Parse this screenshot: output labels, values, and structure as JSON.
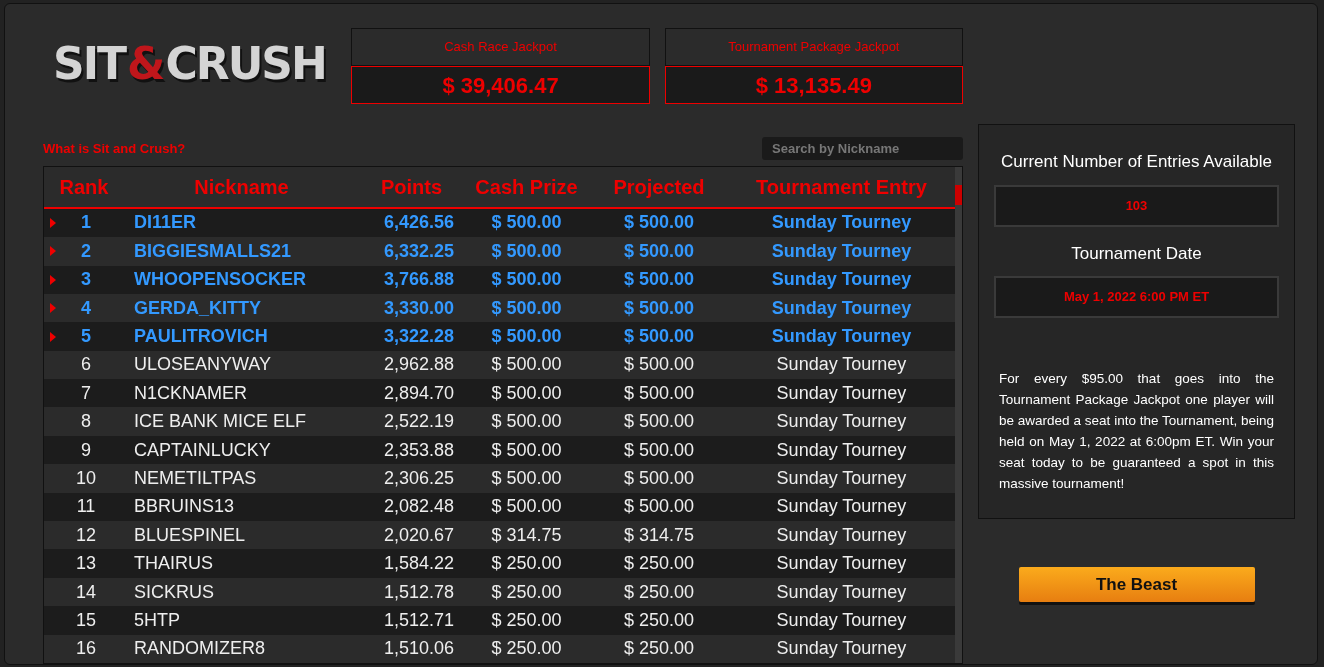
{
  "logo": {
    "word_1": "SIT",
    "ampersand": "&",
    "word_2": "CRUSH"
  },
  "jackpots": [
    {
      "label": "Cash Race Jackpot",
      "value": "$ 39,406.47"
    },
    {
      "label": "Tournament Package Jackpot",
      "value": "$ 13,135.49"
    }
  ],
  "info_link": "What is Sit and Crush?",
  "search": {
    "placeholder": "Search by Nickname"
  },
  "table": {
    "columns": [
      "Rank",
      "Nickname",
      "Points",
      "Cash Prize",
      "Projected",
      "Tournament Entry"
    ],
    "rows": [
      {
        "highlighted": true,
        "cells": [
          "1",
          "DI11ER",
          "6,426.56",
          "$ 500.00",
          "$ 500.00",
          "Sunday Tourney"
        ]
      },
      {
        "highlighted": true,
        "cells": [
          "2",
          "BIGGIESMALLS21",
          "6,332.25",
          "$ 500.00",
          "$ 500.00",
          "Sunday Tourney"
        ]
      },
      {
        "highlighted": true,
        "cells": [
          "3",
          "WHOOPENSOCKER",
          "3,766.88",
          "$ 500.00",
          "$ 500.00",
          "Sunday Tourney"
        ]
      },
      {
        "highlighted": true,
        "cells": [
          "4",
          "GERDA_KITTY",
          "3,330.00",
          "$ 500.00",
          "$ 500.00",
          "Sunday Tourney"
        ]
      },
      {
        "highlighted": true,
        "cells": [
          "5",
          "PAULITROVICH",
          "3,322.28",
          "$ 500.00",
          "$ 500.00",
          "Sunday Tourney"
        ]
      },
      {
        "highlighted": false,
        "cells": [
          "6",
          "ULOSEANYWAY",
          "2,962.88",
          "$ 500.00",
          "$ 500.00",
          "Sunday Tourney"
        ]
      },
      {
        "highlighted": false,
        "cells": [
          "7",
          "N1CKNAMER",
          "2,894.70",
          "$ 500.00",
          "$ 500.00",
          "Sunday Tourney"
        ]
      },
      {
        "highlighted": false,
        "cells": [
          "8",
          "ICE BANK MICE ELF",
          "2,522.19",
          "$ 500.00",
          "$ 500.00",
          "Sunday Tourney"
        ]
      },
      {
        "highlighted": false,
        "cells": [
          "9",
          "CAPTAINLUCKY",
          "2,353.88",
          "$ 500.00",
          "$ 500.00",
          "Sunday Tourney"
        ]
      },
      {
        "highlighted": false,
        "cells": [
          "10",
          "NEMETILTPAS",
          "2,306.25",
          "$ 500.00",
          "$ 500.00",
          "Sunday Tourney"
        ]
      },
      {
        "highlighted": false,
        "cells": [
          "11",
          "BBRUINS13",
          "2,082.48",
          "$ 500.00",
          "$ 500.00",
          "Sunday Tourney"
        ]
      },
      {
        "highlighted": false,
        "cells": [
          "12",
          "BLUESPINEL",
          "2,020.67",
          "$ 314.75",
          "$ 314.75",
          "Sunday Tourney"
        ]
      },
      {
        "highlighted": false,
        "cells": [
          "13",
          "THAIRUS",
          "1,584.22",
          "$ 250.00",
          "$ 250.00",
          "Sunday Tourney"
        ]
      },
      {
        "highlighted": false,
        "cells": [
          "14",
          "SICKRUS",
          "1,512.78",
          "$ 250.00",
          "$ 250.00",
          "Sunday Tourney"
        ]
      },
      {
        "highlighted": false,
        "cells": [
          "15",
          "5HTP",
          "1,512.71",
          "$ 250.00",
          "$ 250.00",
          "Sunday Tourney"
        ]
      },
      {
        "highlighted": false,
        "cells": [
          "16",
          "RANDOMIZER8",
          "1,510.06",
          "$ 250.00",
          "$ 250.00",
          "Sunday Tourney"
        ]
      }
    ]
  },
  "side_panel": {
    "entries_label": "Current Number of Entries Available",
    "entries_value": "103",
    "date_label": "Tournament Date",
    "date_value": "May 1, 2022 6:00 PM ET",
    "description": "For every $95.00 that goes into the Tournament Package Jackpot one player will be awarded a seat into the Tournament, being held on May 1, 2022 at 6:00pm ET. Win your seat today to be guaranteed a spot in this massive tournament!"
  },
  "button": "The Beast"
}
